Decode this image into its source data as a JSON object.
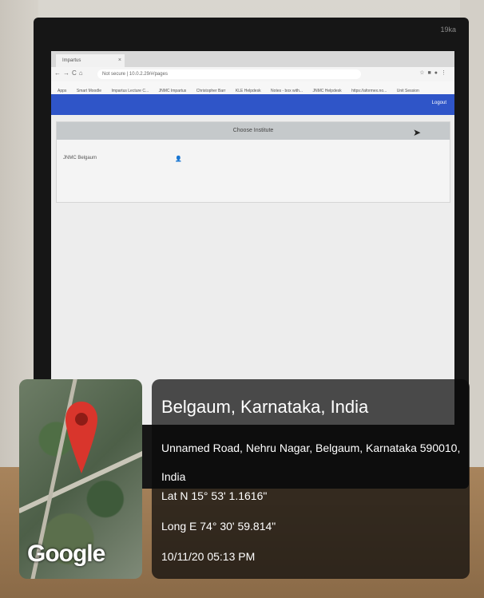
{
  "browser": {
    "tab_title": "Impartus",
    "url": "Not secure | 10.0.2.29/#/pages",
    "bookmarks": [
      "Apps",
      "Smart Moodle",
      "Impartus Lecture C...",
      "JNMC Impartus",
      "Christopher Barr",
      "KLE Helpdesk",
      "Notes - box with...",
      "JNMC Helpdesk",
      "https://aformex.no...",
      "Unit Session"
    ]
  },
  "app": {
    "logout_label": "Logout",
    "card_title": "Choose Institute",
    "institute": "JNMC Belgaum"
  },
  "monitor": {
    "brand": "19ka"
  },
  "geotag": {
    "map_brand": "Google",
    "place": "Belgaum, Karnataka, India",
    "address": "Unnamed Road, Nehru Nagar, Belgaum, Karnataka 590010, India",
    "lat": "Lat N 15° 53' 1.1616\"",
    "long": "Long E 74° 30' 59.814\"",
    "timestamp": "10/11/20 05:13 PM"
  }
}
